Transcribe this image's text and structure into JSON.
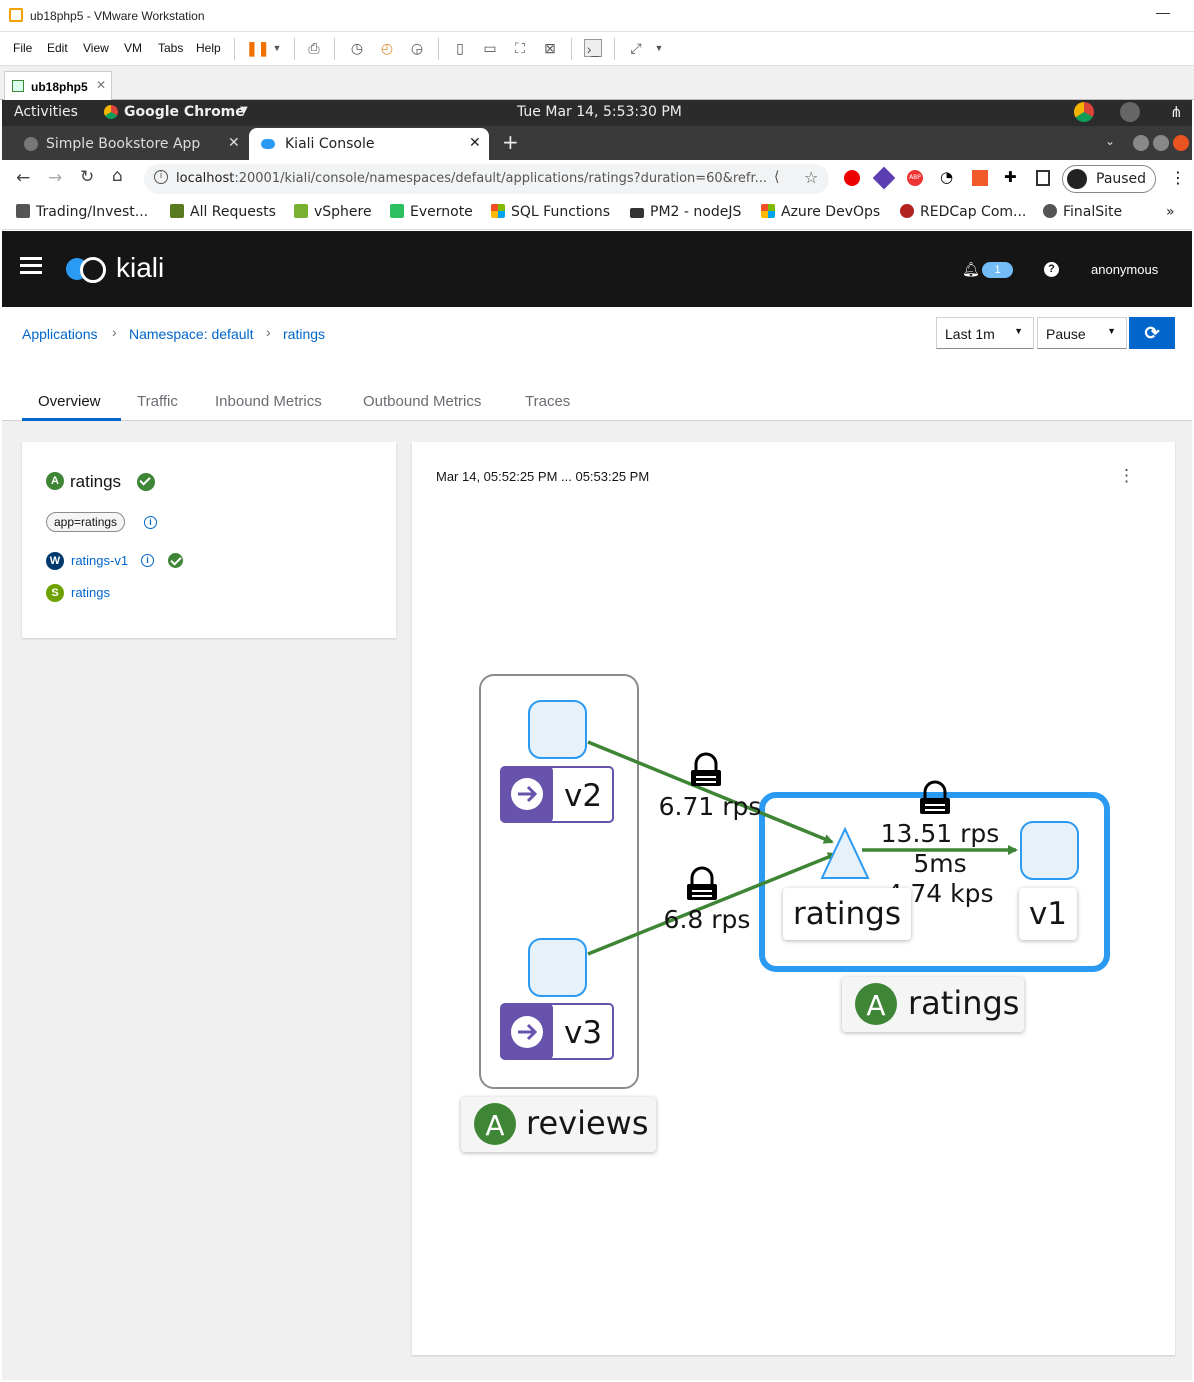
{
  "vmware": {
    "window_title": "ub18php5 - VMware Workstation",
    "menu": [
      "File",
      "Edit",
      "View",
      "VM",
      "Tabs",
      "Help"
    ],
    "tab_label": "ub18php5"
  },
  "gnome": {
    "activities": "Activities",
    "app_menu": "Google Chrome",
    "clock": "Tue Mar 14,  5:53:30 PM"
  },
  "chrome": {
    "tabs": [
      {
        "label": "Simple Bookstore App",
        "active": false
      },
      {
        "label": "Kiali Console",
        "active": true
      }
    ],
    "url_host": "localhost",
    "url_rest": ":20001/kiali/console/namespaces/default/applications/ratings?duration=60&refr...",
    "profile_label": "Paused",
    "bookmarks": [
      {
        "label": "Trading/Invest...",
        "color": "#444444"
      },
      {
        "label": "All Requests",
        "color": "#5a7a20"
      },
      {
        "label": "vSphere",
        "color": "#7ab030"
      },
      {
        "label": "Evernote",
        "color": "#2dbe60"
      },
      {
        "label": "SQL Functions",
        "color": "#f25022"
      },
      {
        "label": "PM2 - nodeJS",
        "color": "#333333"
      },
      {
        "label": "Azure DevOps",
        "color": "#f25022"
      },
      {
        "label": "REDCap Com...",
        "color": "#b22222"
      },
      {
        "label": "FinalSite",
        "color": "#555555"
      }
    ],
    "bookmarks_more": "»"
  },
  "kiali": {
    "logo_text": "kiali",
    "notifications_count": "1",
    "help_icon": "?",
    "user": "anonymous",
    "breadcrumb": [
      "Applications",
      "Namespace: default",
      "ratings"
    ],
    "duration_select": "Last 1m",
    "refresh_select": "Pause",
    "tabs": [
      "Overview",
      "Traffic",
      "Inbound Metrics",
      "Outbound Metrics",
      "Traces"
    ],
    "active_tab": "Overview",
    "app_card": {
      "app_badge": "A",
      "app_name": "ratings",
      "label_chip": "app=ratings",
      "workload_badge": "W",
      "workload_name": "ratings-v1",
      "service_badge": "S",
      "service_name": "ratings"
    },
    "graph": {
      "time_range": "Mar 14, 05:52:25 PM ... 05:53:25 PM",
      "reviews_badge": "A",
      "reviews_label": "reviews",
      "ratings_badge": "A",
      "ratings_box_label": "ratings",
      "node_v2": "v2",
      "node_v3": "v3",
      "service_ratings": "ratings",
      "node_v1": "v1",
      "edge_v2": "6.71 rps",
      "edge_v3": "6.8 rps",
      "edge_v1_rps": "13.51 rps",
      "edge_v1_ms": "5ms",
      "edge_v1_kps": "4.74 kps"
    },
    "colors": {
      "accent": "#0066cc",
      "edge": "#3e8635",
      "app_badge": "#3e8635",
      "workload_badge": "#003a6d",
      "service_badge": "#6ca100",
      "version_badge": "#6753ac",
      "box_selected": "#2b9af3"
    }
  }
}
